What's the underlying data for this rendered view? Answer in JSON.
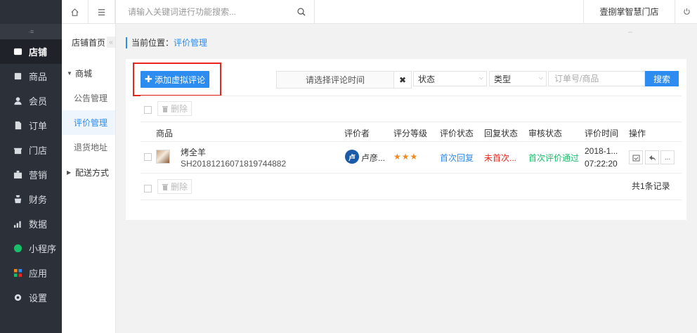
{
  "sidebar": {
    "collapse_glyph": "·≡",
    "items": [
      {
        "label": "店铺",
        "icon": "store-icon",
        "active": true
      },
      {
        "label": "商品",
        "icon": "goods-icon"
      },
      {
        "label": "会员",
        "icon": "member-icon"
      },
      {
        "label": "订单",
        "icon": "order-icon"
      },
      {
        "label": "门店",
        "icon": "shop-icon"
      },
      {
        "label": "营销",
        "icon": "marketing-icon"
      },
      {
        "label": "财务",
        "icon": "finance-icon"
      },
      {
        "label": "数据",
        "icon": "data-icon"
      },
      {
        "label": "小程序",
        "icon": "miniprogram-icon"
      },
      {
        "label": "应用",
        "icon": "apps-icon"
      },
      {
        "label": "设置",
        "icon": "settings-icon"
      }
    ]
  },
  "subsidebar": {
    "title": "店铺首页",
    "collapse_glyph": "«",
    "group_mall": "商城",
    "items": [
      "公告管理",
      "评价管理",
      "退货地址"
    ],
    "group_delivery": "配送方式"
  },
  "topbar": {
    "search_placeholder": "请输入关键词进行功能搜索...",
    "store_name": "壹捌掌智慧门店"
  },
  "breadcrumb": {
    "prefix": "当前位置：",
    "current": "评价管理"
  },
  "toolbar": {
    "add_label": "添加虚拟评论",
    "time_placeholder": "请选择评论时间",
    "status_select": "状态",
    "type_select": "类型",
    "order_placeholder": "订单号/商品",
    "search_label": "搜索",
    "delete_label": "删除"
  },
  "table": {
    "headers": [
      "商品",
      "评价者",
      "评分等级",
      "评价状态",
      "回复状态",
      "审核状态",
      "评价时间",
      "操作"
    ],
    "rows": [
      {
        "product_name": "烤全羊",
        "product_code": "SH20181216071819744882",
        "reviewer": "卢彦...",
        "stars": "★★★",
        "eval_status": "首次回复",
        "reply_status": "未首次...",
        "audit_status": "首次评价通过",
        "date": "2018-1...",
        "time": "07:22:20",
        "more": "..."
      }
    ],
    "total": "共1条记录"
  },
  "colors": {
    "accent": "#2d8cf0",
    "sidebar_bg": "#2c3038",
    "reply_red": "#e8261e",
    "audit_green": "#19be6b",
    "star_orange": "#f08a1c",
    "highlight_box": "#e8261e"
  }
}
